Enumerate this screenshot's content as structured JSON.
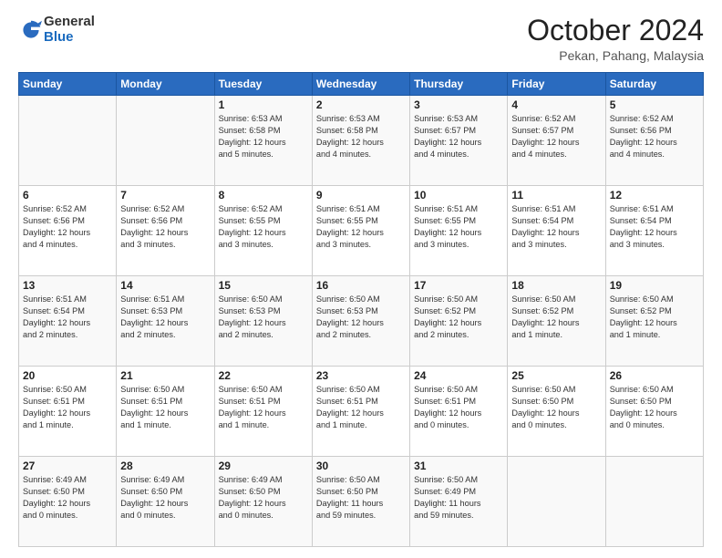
{
  "header": {
    "logo_general": "General",
    "logo_blue": "Blue",
    "month_title": "October 2024",
    "location": "Pekan, Pahang, Malaysia"
  },
  "weekdays": [
    "Sunday",
    "Monday",
    "Tuesday",
    "Wednesday",
    "Thursday",
    "Friday",
    "Saturday"
  ],
  "weeks": [
    [
      {
        "day": "",
        "content": ""
      },
      {
        "day": "",
        "content": ""
      },
      {
        "day": "1",
        "content": "Sunrise: 6:53 AM\nSunset: 6:58 PM\nDaylight: 12 hours\nand 5 minutes."
      },
      {
        "day": "2",
        "content": "Sunrise: 6:53 AM\nSunset: 6:58 PM\nDaylight: 12 hours\nand 4 minutes."
      },
      {
        "day": "3",
        "content": "Sunrise: 6:53 AM\nSunset: 6:57 PM\nDaylight: 12 hours\nand 4 minutes."
      },
      {
        "day": "4",
        "content": "Sunrise: 6:52 AM\nSunset: 6:57 PM\nDaylight: 12 hours\nand 4 minutes."
      },
      {
        "day": "5",
        "content": "Sunrise: 6:52 AM\nSunset: 6:56 PM\nDaylight: 12 hours\nand 4 minutes."
      }
    ],
    [
      {
        "day": "6",
        "content": "Sunrise: 6:52 AM\nSunset: 6:56 PM\nDaylight: 12 hours\nand 4 minutes."
      },
      {
        "day": "7",
        "content": "Sunrise: 6:52 AM\nSunset: 6:56 PM\nDaylight: 12 hours\nand 3 minutes."
      },
      {
        "day": "8",
        "content": "Sunrise: 6:52 AM\nSunset: 6:55 PM\nDaylight: 12 hours\nand 3 minutes."
      },
      {
        "day": "9",
        "content": "Sunrise: 6:51 AM\nSunset: 6:55 PM\nDaylight: 12 hours\nand 3 minutes."
      },
      {
        "day": "10",
        "content": "Sunrise: 6:51 AM\nSunset: 6:55 PM\nDaylight: 12 hours\nand 3 minutes."
      },
      {
        "day": "11",
        "content": "Sunrise: 6:51 AM\nSunset: 6:54 PM\nDaylight: 12 hours\nand 3 minutes."
      },
      {
        "day": "12",
        "content": "Sunrise: 6:51 AM\nSunset: 6:54 PM\nDaylight: 12 hours\nand 3 minutes."
      }
    ],
    [
      {
        "day": "13",
        "content": "Sunrise: 6:51 AM\nSunset: 6:54 PM\nDaylight: 12 hours\nand 2 minutes."
      },
      {
        "day": "14",
        "content": "Sunrise: 6:51 AM\nSunset: 6:53 PM\nDaylight: 12 hours\nand 2 minutes."
      },
      {
        "day": "15",
        "content": "Sunrise: 6:50 AM\nSunset: 6:53 PM\nDaylight: 12 hours\nand 2 minutes."
      },
      {
        "day": "16",
        "content": "Sunrise: 6:50 AM\nSunset: 6:53 PM\nDaylight: 12 hours\nand 2 minutes."
      },
      {
        "day": "17",
        "content": "Sunrise: 6:50 AM\nSunset: 6:52 PM\nDaylight: 12 hours\nand 2 minutes."
      },
      {
        "day": "18",
        "content": "Sunrise: 6:50 AM\nSunset: 6:52 PM\nDaylight: 12 hours\nand 1 minute."
      },
      {
        "day": "19",
        "content": "Sunrise: 6:50 AM\nSunset: 6:52 PM\nDaylight: 12 hours\nand 1 minute."
      }
    ],
    [
      {
        "day": "20",
        "content": "Sunrise: 6:50 AM\nSunset: 6:51 PM\nDaylight: 12 hours\nand 1 minute."
      },
      {
        "day": "21",
        "content": "Sunrise: 6:50 AM\nSunset: 6:51 PM\nDaylight: 12 hours\nand 1 minute."
      },
      {
        "day": "22",
        "content": "Sunrise: 6:50 AM\nSunset: 6:51 PM\nDaylight: 12 hours\nand 1 minute."
      },
      {
        "day": "23",
        "content": "Sunrise: 6:50 AM\nSunset: 6:51 PM\nDaylight: 12 hours\nand 1 minute."
      },
      {
        "day": "24",
        "content": "Sunrise: 6:50 AM\nSunset: 6:51 PM\nDaylight: 12 hours\nand 0 minutes."
      },
      {
        "day": "25",
        "content": "Sunrise: 6:50 AM\nSunset: 6:50 PM\nDaylight: 12 hours\nand 0 minutes."
      },
      {
        "day": "26",
        "content": "Sunrise: 6:50 AM\nSunset: 6:50 PM\nDaylight: 12 hours\nand 0 minutes."
      }
    ],
    [
      {
        "day": "27",
        "content": "Sunrise: 6:49 AM\nSunset: 6:50 PM\nDaylight: 12 hours\nand 0 minutes."
      },
      {
        "day": "28",
        "content": "Sunrise: 6:49 AM\nSunset: 6:50 PM\nDaylight: 12 hours\nand 0 minutes."
      },
      {
        "day": "29",
        "content": "Sunrise: 6:49 AM\nSunset: 6:50 PM\nDaylight: 12 hours\nand 0 minutes."
      },
      {
        "day": "30",
        "content": "Sunrise: 6:50 AM\nSunset: 6:50 PM\nDaylight: 11 hours\nand 59 minutes."
      },
      {
        "day": "31",
        "content": "Sunrise: 6:50 AM\nSunset: 6:49 PM\nDaylight: 11 hours\nand 59 minutes."
      },
      {
        "day": "",
        "content": ""
      },
      {
        "day": "",
        "content": ""
      }
    ]
  ]
}
